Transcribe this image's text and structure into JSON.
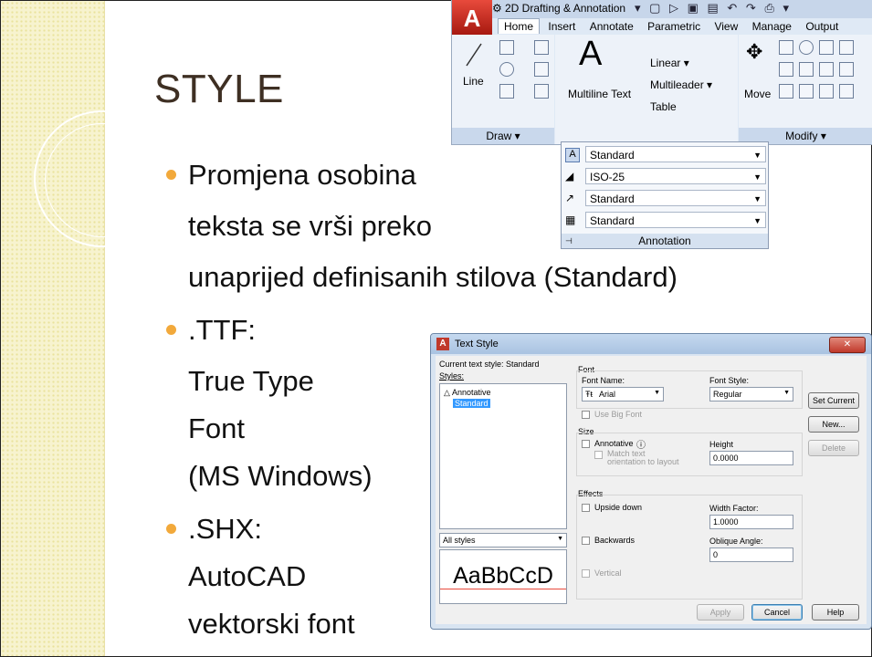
{
  "slide": {
    "title": "STYLE",
    "bullets": [
      {
        "lines": [
          "Promjena osobina",
          "teksta se vrši preko",
          "unaprijed definisanih stilova (Standard)"
        ]
      },
      {
        "lines": [
          ".TTF:",
          "True Type",
          "Font",
          "(MS Windows)"
        ]
      },
      {
        "lines": [
          ".SHX:",
          "AutoCAD",
          "vektorski font"
        ]
      }
    ],
    "accent_color": "#f2a93b",
    "title_color": "#3e2f23"
  },
  "ribbon": {
    "workspace": "2D Drafting & Annotation",
    "tabs": [
      "Home",
      "Insert",
      "Annotate",
      "Parametric",
      "View",
      "Manage",
      "Output"
    ],
    "draw": {
      "line": "Line",
      "panel": "Draw ▾"
    },
    "annotation": {
      "multiline_text": "Multiline Text",
      "linear": "Linear ▾",
      "multileader": "Multileader ▾",
      "table": "Table",
      "panel": "Annotation",
      "styles": [
        "Standard",
        "ISO-25",
        "Standard",
        "Standard"
      ]
    },
    "modify": {
      "move": "Move",
      "panel": "Modify ▾"
    }
  },
  "dialog": {
    "title": "Text Style",
    "current_style": "Current text style:  Standard",
    "styles_label": "Styles:",
    "styles": [
      "Annotative",
      "Standard"
    ],
    "filter": "All styles",
    "preview": "AaBbCcD",
    "font_group": "Font",
    "font_name_label": "Font Name:",
    "font_name": "Arial",
    "font_style_label": "Font Style:",
    "font_style": "Regular",
    "use_big_font": "Use Big Font",
    "size_group": "Size",
    "annotative": "Annotative",
    "match_orientation": "Match text orientation to layout",
    "height_label": "Height",
    "height": "0.0000",
    "effects_group": "Effects",
    "upside_down": "Upside down",
    "backwards": "Backwards",
    "vertical": "Vertical",
    "width_factor_label": "Width Factor:",
    "width_factor": "1.0000",
    "oblique_label": "Oblique Angle:",
    "oblique": "0",
    "buttons": {
      "set_current": "Set Current",
      "new": "New...",
      "delete": "Delete",
      "apply": "Apply",
      "cancel": "Cancel",
      "help": "Help"
    }
  }
}
